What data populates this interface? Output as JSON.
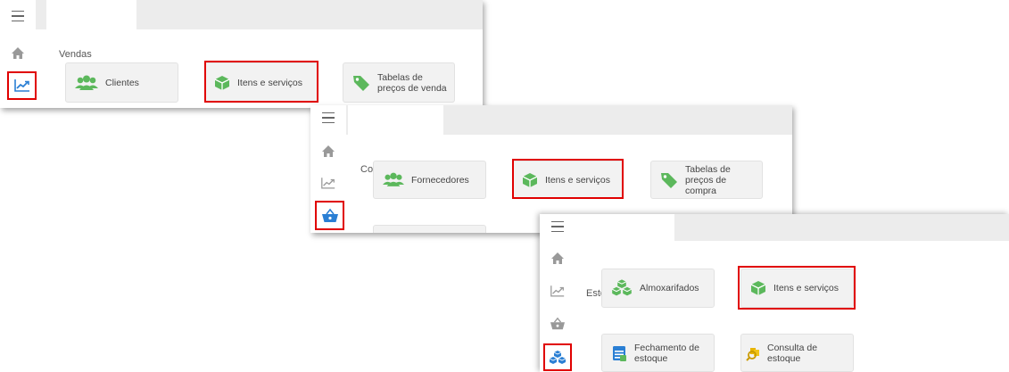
{
  "panels": [
    {
      "tab": "Vendas",
      "cards": [
        "Clientes",
        "Itens e serviços",
        "Tabelas de preços de venda"
      ]
    },
    {
      "tab": "Compras",
      "cards": [
        "Fornecedores",
        "Itens e serviços",
        "Tabelas de preços de compra"
      ]
    },
    {
      "tab": "Estoque",
      "cards": [
        "Almoxarifados",
        "Itens e serviços",
        "Fechamento de estoque",
        "Consulta de estoque"
      ]
    }
  ],
  "colors": {
    "highlight": "#e00000",
    "icon_green": "#5cb85c",
    "icon_blue": "#2a7fd4",
    "icon_yellow": "#e8b400",
    "topbar": "#ececec"
  }
}
